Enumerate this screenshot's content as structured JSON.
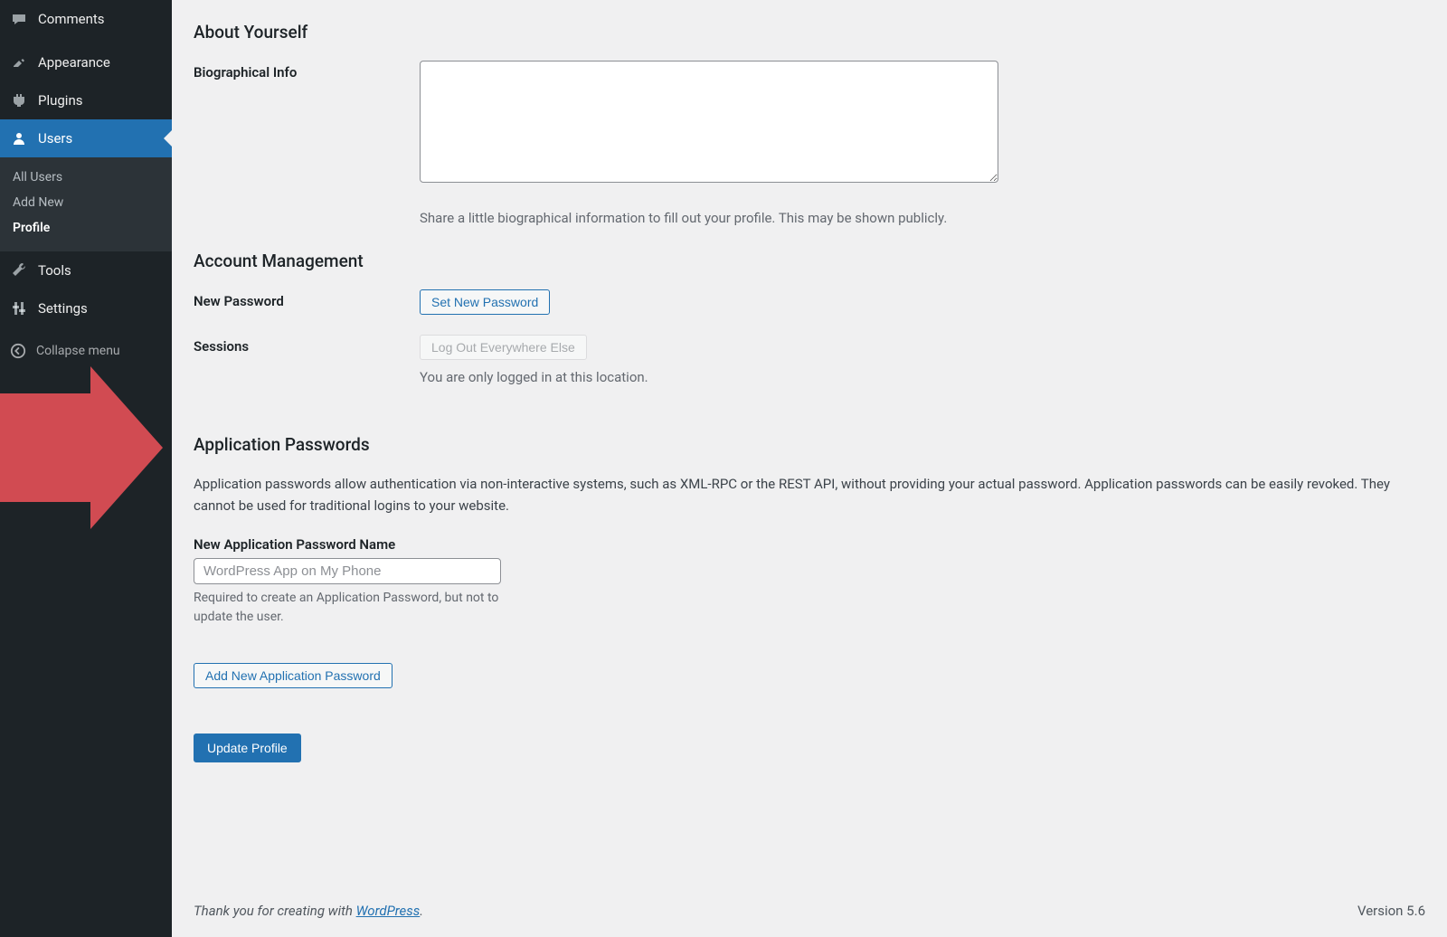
{
  "sidebar": {
    "items": [
      {
        "label": "Comments"
      },
      {
        "label": "Appearance"
      },
      {
        "label": "Plugins"
      },
      {
        "label": "Users"
      },
      {
        "label": "Tools"
      },
      {
        "label": "Settings"
      }
    ],
    "submenu": [
      {
        "label": "All Users"
      },
      {
        "label": "Add New"
      },
      {
        "label": "Profile"
      }
    ],
    "collapse_label": "Collapse menu"
  },
  "sections": {
    "about_yourself_title": "About Yourself",
    "bio_label": "Biographical Info",
    "bio_description": "Share a little biographical information to fill out your profile. This may be shown publicly.",
    "account_mgmt_title": "Account Management",
    "new_password_label": "New Password",
    "set_new_password_btn": "Set New Password",
    "sessions_label": "Sessions",
    "logout_everywhere_btn": "Log Out Everywhere Else",
    "sessions_note": "You are only logged in at this location.",
    "app_passwords_title": "Application Passwords",
    "app_passwords_desc": "Application passwords allow authentication via non-interactive systems, such as XML-RPC or the REST API, without providing your actual password. Application passwords can be easily revoked. They cannot be used for traditional logins to your website.",
    "new_app_pw_label": "New Application Password Name",
    "new_app_pw_placeholder": "WordPress App on My Phone",
    "new_app_pw_help": "Required to create an Application Password, but not to update the user.",
    "add_new_app_pw_btn": "Add New Application Password",
    "update_profile_btn": "Update Profile"
  },
  "footer": {
    "thanks_prefix": "Thank you for creating with ",
    "wp_link_text": "WordPress",
    "thanks_suffix": ".",
    "version": "Version 5.6"
  }
}
